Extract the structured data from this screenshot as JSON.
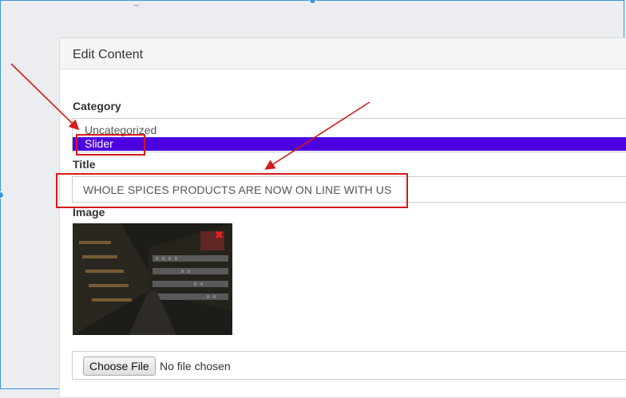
{
  "window": {
    "minimize_glyph": "_"
  },
  "panel": {
    "title": "Edit Content"
  },
  "form": {
    "category": {
      "label": "Category",
      "options": [
        "Uncategorized",
        "Slider"
      ],
      "selected": "Slider"
    },
    "title": {
      "label": "Title",
      "value": "WHOLE SPICES PRODUCTS ARE NOW ON LINE WITH US"
    },
    "image": {
      "label": "Image",
      "remove_icon": "close-icon",
      "remove_glyph": "✖"
    },
    "file": {
      "button_label": "Choose File",
      "status": "No file chosen"
    }
  },
  "colors": {
    "selected_option_bg": "#4c00e0",
    "annotation": "#d61a1a",
    "frame": "#3b95d8"
  }
}
